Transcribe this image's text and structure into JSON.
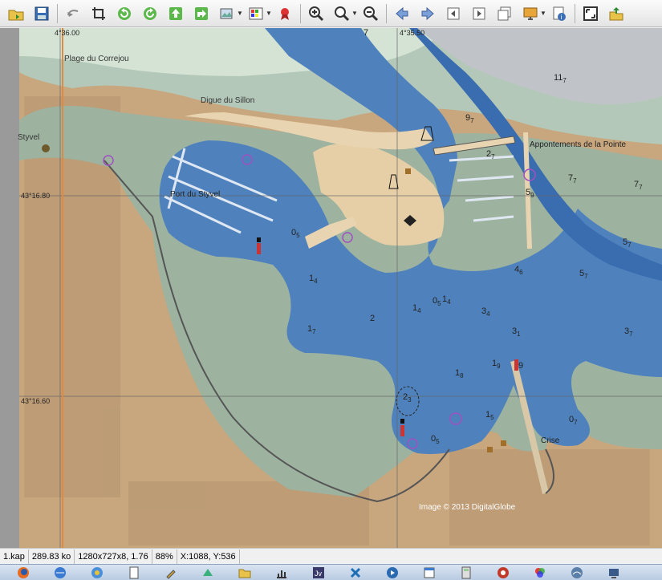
{
  "toolbar": {
    "buttons": [
      "open-folder-icon",
      "save-icon",
      "undo-icon",
      "crop-icon",
      "rotate-left-icon",
      "rotate-right-icon",
      "upload-icon",
      "redo-arrow-icon",
      "image-settings-icon",
      "palette-icon",
      "ribbon-icon",
      "zoom-in-icon",
      "zoom-options-icon",
      "zoom-out-icon",
      "back-arrow-icon",
      "forward-arrow-icon",
      "prev-page-icon",
      "next-page-icon",
      "pages-icon",
      "slideshow-icon",
      "info-icon",
      "fullscreen-icon",
      "export-icon"
    ]
  },
  "map": {
    "coords": {
      "lon1": "4°36.00",
      "lon2": "4°35.50",
      "lat1": "43°16.80",
      "lat2": "43°16.60"
    },
    "places": {
      "plage": "Plage du Correjou",
      "digue": "Digue du Sillon",
      "styvel": "Styvel",
      "port": "Port du Styvel",
      "appontements": "Appontements de la Pointe",
      "crise": "Crise",
      "image_credit": "Image © 2013 DigitalGlobe"
    },
    "soundings": [
      {
        "id": "s1",
        "main": "11",
        "sub": "7"
      },
      {
        "id": "s2",
        "main": "9",
        "sub": "7"
      },
      {
        "id": "s3",
        "main": "2",
        "sub": "7"
      },
      {
        "id": "s4",
        "main": "7",
        "sub": "7"
      },
      {
        "id": "s5",
        "main": "7",
        "sub": "7"
      },
      {
        "id": "s6",
        "main": "5",
        "sub": "9"
      },
      {
        "id": "s7",
        "main": "5",
        "sub": "7"
      },
      {
        "id": "s8",
        "main": "4",
        "sub": "6"
      },
      {
        "id": "s9",
        "main": "5",
        "sub": "7"
      },
      {
        "id": "s10",
        "main": "0",
        "sub": "5"
      },
      {
        "id": "s11",
        "main": "1",
        "sub": "4"
      },
      {
        "id": "s12",
        "main": "1",
        "sub": "4"
      },
      {
        "id": "s13",
        "main": "1",
        "sub": "4"
      },
      {
        "id": "s14",
        "main": "0",
        "sub": "5"
      },
      {
        "id": "s15",
        "main": "3",
        "sub": "4"
      },
      {
        "id": "s16",
        "main": "3",
        "sub": "1"
      },
      {
        "id": "s17",
        "main": "3",
        "sub": "7"
      },
      {
        "id": "s18",
        "main": "1",
        "sub": "7"
      },
      {
        "id": "s19",
        "main": "2",
        "sub": ""
      },
      {
        "id": "s20",
        "main": "1",
        "sub": "8"
      },
      {
        "id": "s21",
        "main": "1",
        "sub": "9"
      },
      {
        "id": "s22",
        "main": "9",
        "sub": ""
      },
      {
        "id": "s23",
        "main": "2",
        "sub": "3"
      },
      {
        "id": "s24",
        "main": "1",
        "sub": "5"
      },
      {
        "id": "s25",
        "main": "0",
        "sub": "7"
      },
      {
        "id": "s26",
        "main": "0",
        "sub": "5"
      },
      {
        "id": "s27",
        "main": "7",
        "sub": ""
      }
    ]
  },
  "status": {
    "filename": "1.kap",
    "filesize": "289.83 ko",
    "dimensions": "1280x727x8, 1.76",
    "zoom": "88%",
    "cursor": "X:1088, Y:536"
  },
  "taskbar": {
    "apps": [
      "firefox-icon",
      "explorer-icon",
      "ie-icon",
      "document-icon",
      "pen-icon",
      "paint-icon",
      "folder-icon",
      "chart-icon",
      "java-icon",
      "tools-icon",
      "media-icon",
      "calendar-icon",
      "calculator-icon",
      "security-icon",
      "colors-icon",
      "network-icon",
      "system-icon"
    ]
  }
}
